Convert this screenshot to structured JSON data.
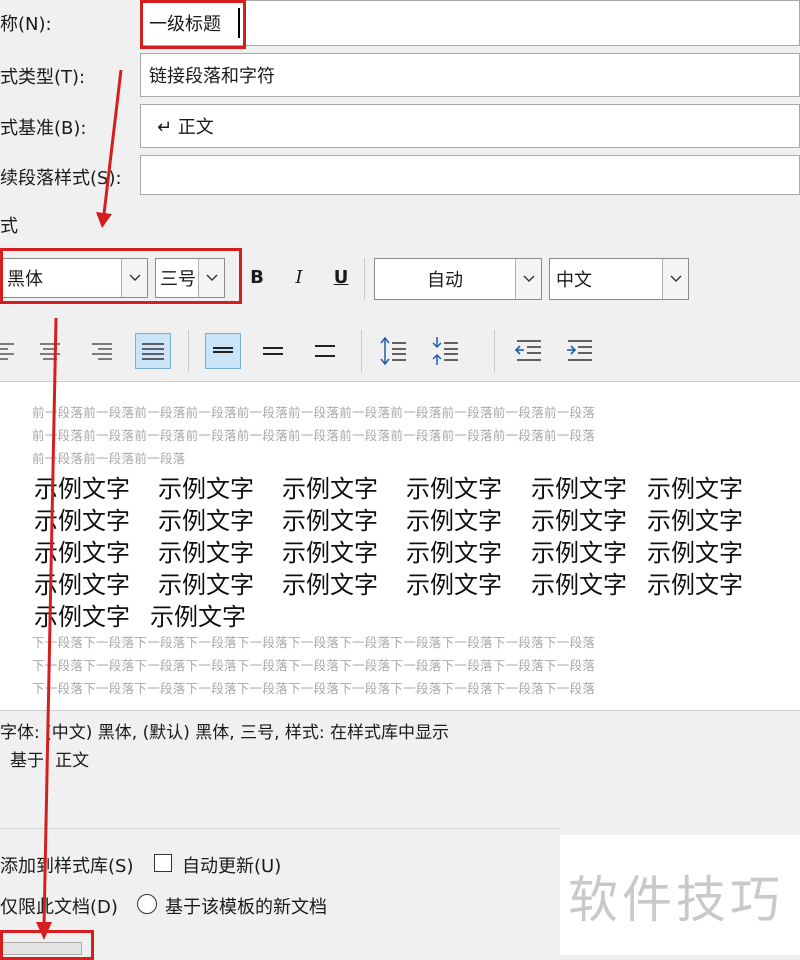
{
  "properties": {
    "name_label": "称(N):",
    "name_value": "一级标题",
    "style_type_label": "式类型(T):",
    "style_type_value": "链接段落和字符",
    "based_on_label": "式基准(B):",
    "based_on_value": "↵ 正文",
    "following_label": "续段落样式(S):",
    "following_value": ""
  },
  "format": {
    "section_label": "式",
    "font": "黑体",
    "size": "三号",
    "bold": "B",
    "italic": "I",
    "underline": "U",
    "color": "自动",
    "script": "中文"
  },
  "preview": {
    "prev_lines": [
      "前一段落前一段落前一段落前一段落前一段落前一段落前一段落前一段落前一段落前一段落前一段落",
      "前一段落前一段落前一段落前一段落前一段落前一段落前一段落前一段落前一段落前一段落前一段落",
      "前一段落前一段落前一段落"
    ],
    "sample_text": "示例文字",
    "next_lines": [
      "下一段落下一段落下一段落下一段落下一段落下一段落下一段落下一段落下一段落下一段落下一段落",
      "下一段落下一段落下一段落下一段落下一段落下一段落下一段落下一段落下一段落下一段落下一段落",
      "下一段落下一段落下一段落下一段落下一段落下一段落下一段落下一段落下一段落下一段落下一段落"
    ]
  },
  "description": {
    "line1": "字体: (中文) 黑体, (默认) 黑体, 三号, 样式: 在样式库中显示",
    "line2": "基于: 正文"
  },
  "options": {
    "add_to_gallery": "添加到样式库(S)",
    "auto_update": "自动更新(U)",
    "this_doc_only": "仅限此文档(D)",
    "new_docs": "基于该模板的新文档"
  },
  "watermark": "软件技巧",
  "colors": {
    "highlight": "#d61e1e",
    "active_button": "#cce4f7"
  }
}
